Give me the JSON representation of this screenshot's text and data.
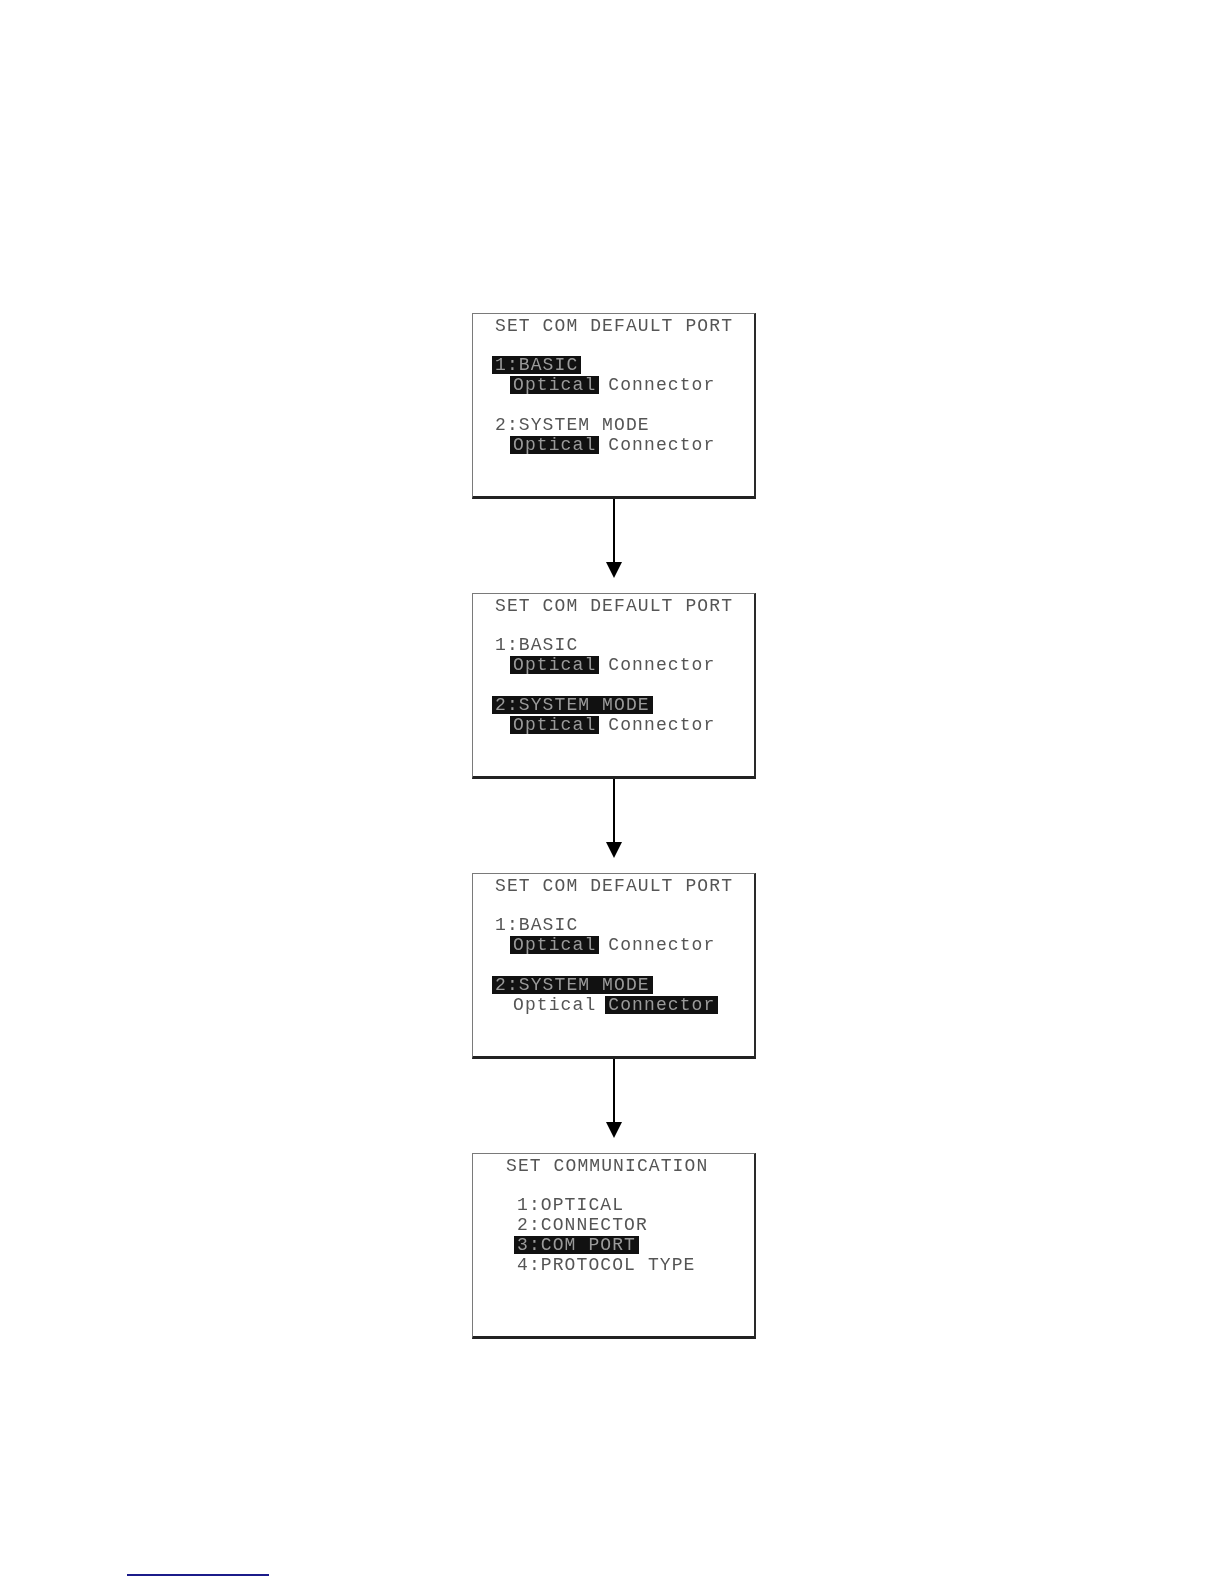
{
  "screens": [
    {
      "kind": "port",
      "title": "SET COM DEFAULT PORT",
      "items": [
        {
          "label": "1:BASIC",
          "selected": true,
          "options": [
            {
              "label": "Optical",
              "selected": true
            },
            {
              "label": "Connector",
              "selected": false
            }
          ]
        },
        {
          "label": "2:SYSTEM MODE",
          "selected": false,
          "options": [
            {
              "label": "Optical",
              "selected": true
            },
            {
              "label": "Connector",
              "selected": false
            }
          ]
        }
      ]
    },
    {
      "kind": "port",
      "title": "SET COM DEFAULT PORT",
      "items": [
        {
          "label": "1:BASIC",
          "selected": false,
          "options": [
            {
              "label": "Optical",
              "selected": true
            },
            {
              "label": "Connector",
              "selected": false
            }
          ]
        },
        {
          "label": "2:SYSTEM MODE",
          "selected": true,
          "options": [
            {
              "label": "Optical",
              "selected": true
            },
            {
              "label": "Connector",
              "selected": false
            }
          ]
        }
      ]
    },
    {
      "kind": "port",
      "title": "SET COM DEFAULT PORT",
      "items": [
        {
          "label": "1:BASIC",
          "selected": false,
          "options": [
            {
              "label": "Optical",
              "selected": true
            },
            {
              "label": "Connector",
              "selected": false
            }
          ]
        },
        {
          "label": "2:SYSTEM MODE",
          "selected": true,
          "options": [
            {
              "label": "Optical",
              "selected": false
            },
            {
              "label": "Connector",
              "selected": true
            }
          ]
        }
      ]
    },
    {
      "kind": "menu",
      "title": "SET COMMUNICATION",
      "items": [
        {
          "label": "1:OPTICAL",
          "selected": false
        },
        {
          "label": "2:CONNECTOR",
          "selected": false
        },
        {
          "label": "3:COM PORT",
          "selected": true
        },
        {
          "label": "4:PROTOCOL TYPE",
          "selected": false
        }
      ]
    }
  ]
}
